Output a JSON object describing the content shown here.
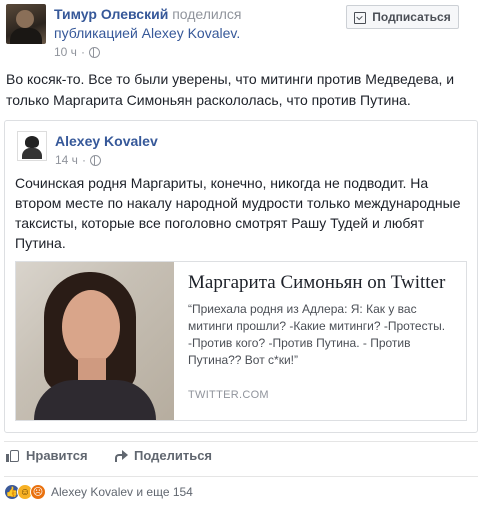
{
  "header": {
    "author": "Тимур Олевский",
    "shared_word": "поделился",
    "shared_rest": "публикацией Alexey Kovalev.",
    "time": "10 ч",
    "privacy_icon": "globe-icon",
    "subscribe_label": "Подписаться"
  },
  "post": {
    "text": "Во косяк-то. Все то были уверены, что митинги против Медведева, и только Маргарита Симоньян раскололась, что против Путина."
  },
  "shared": {
    "author": "Alexey Kovalev",
    "time": "14 ч",
    "text": "Сочинская родня Маргариты, конечно, никогда не подводит. На втором месте по накалу народной мудрости только международные таксисты, которые все поголовно смотрят Рашу Тудей и любят Путина.",
    "card": {
      "title": "Маргарита Симоньян on Twitter",
      "description": "“Приехала родня из Адлера: Я: Как у вас митинги прошли? -Какие митинги? -Протесты. -Против кого? -Против Путина. - Против Путина?? Вот с*ки!”",
      "domain": "TWITTER.COM"
    }
  },
  "actions": {
    "like_label": "Нравится",
    "share_label": "Поделиться"
  },
  "reactions": {
    "icons": [
      "like-reaction-icon",
      "haha-reaction-icon",
      "angry-reaction-icon"
    ],
    "text": "Alexey Kovalev и еще 154"
  },
  "colors": {
    "link": "#365899",
    "muted": "#90949c",
    "border": "#dddfe2"
  }
}
